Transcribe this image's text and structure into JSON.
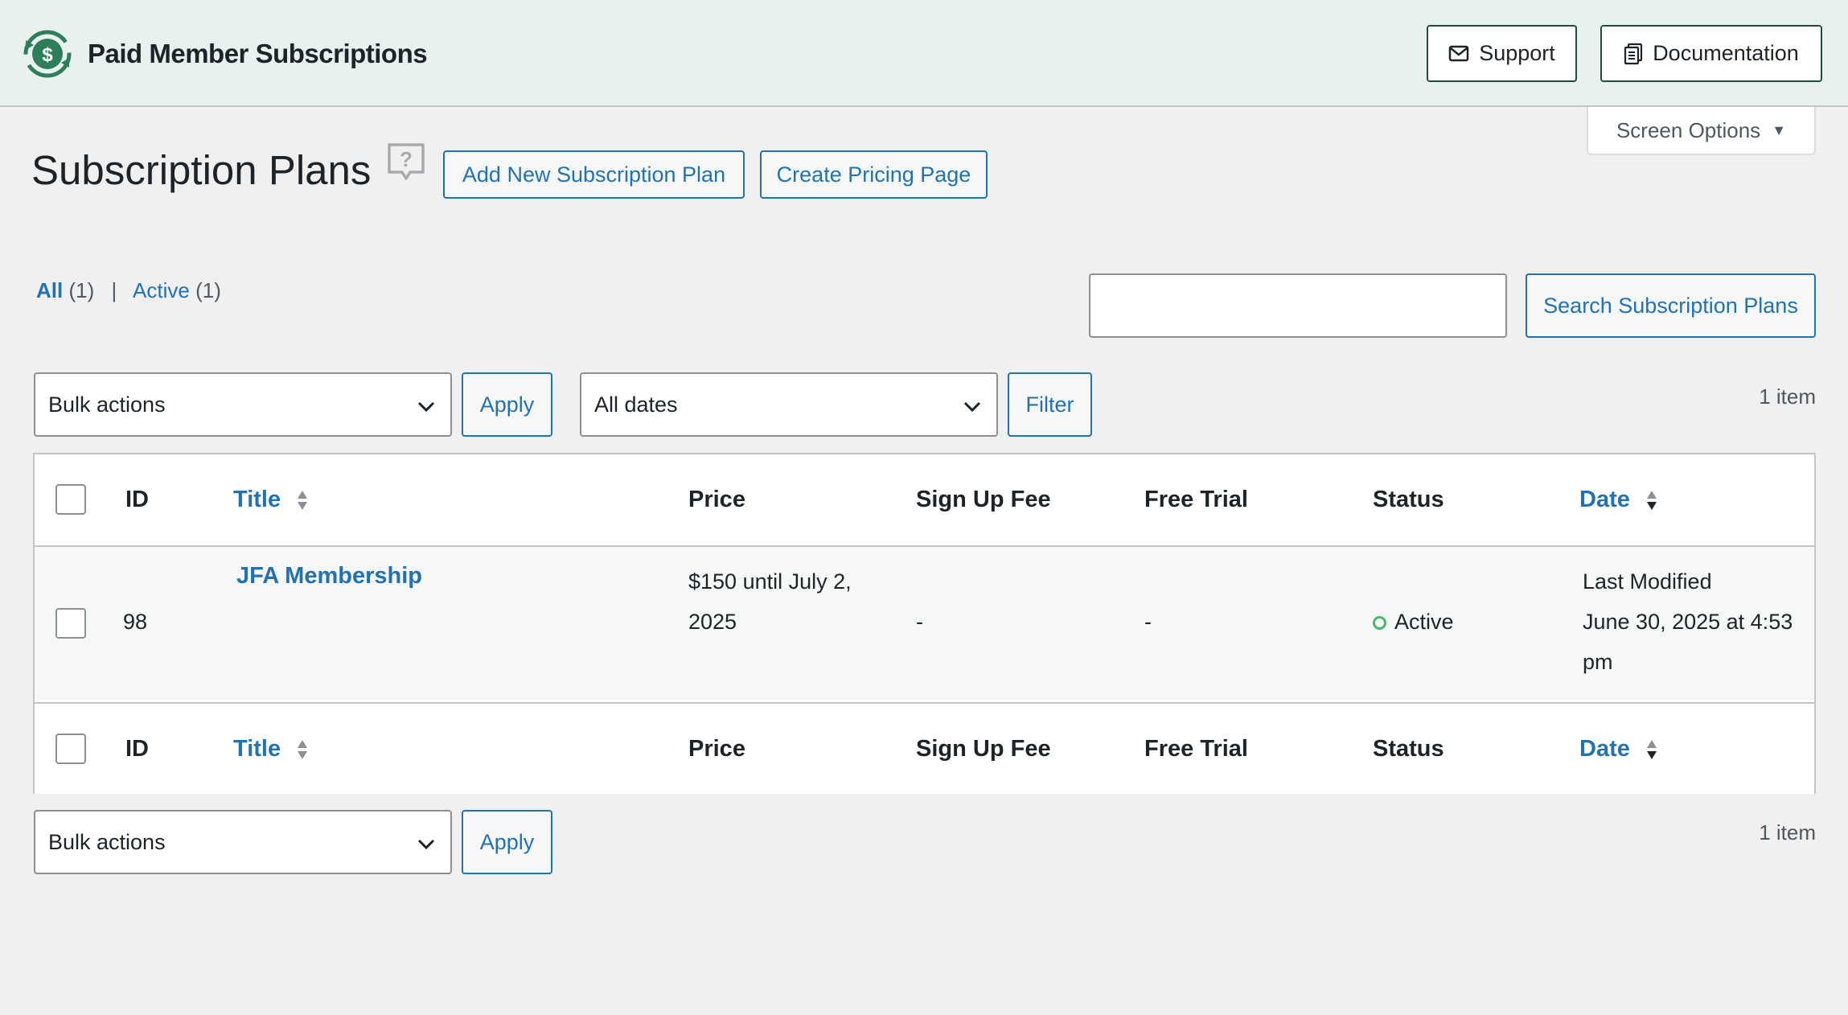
{
  "header": {
    "brand_name": "Paid Member Subscriptions",
    "support_label": "Support",
    "documentation_label": "Documentation"
  },
  "screen_options": {
    "label": "Screen Options"
  },
  "page": {
    "title": "Subscription Plans",
    "add_new_label": "Add New Subscription Plan",
    "create_pricing_label": "Create Pricing Page"
  },
  "views": {
    "all_label": "All",
    "all_count": "(1)",
    "separator": "|",
    "active_label": "Active",
    "active_count": "(1)"
  },
  "search": {
    "value": "",
    "button_label": "Search Subscription Plans"
  },
  "tablenav_top": {
    "bulk_actions": "Bulk actions",
    "apply_label": "Apply",
    "dates": "All dates",
    "filter_label": "Filter",
    "item_count": "1 item"
  },
  "tablenav_bottom": {
    "bulk_actions": "Bulk actions",
    "apply_label": "Apply",
    "item_count": "1 item"
  },
  "table": {
    "columns": {
      "id": "ID",
      "title": "Title",
      "price": "Price",
      "signup_fee": "Sign Up Fee",
      "free_trial": "Free Trial",
      "status": "Status",
      "date": "Date"
    },
    "rows": [
      {
        "id": "98",
        "title": "JFA Membership",
        "price_line1": "$150 until July 2,",
        "price_line2": "2025",
        "signup_fee": "-",
        "free_trial": "-",
        "status": "Active",
        "date_line1": "Last Modified",
        "date_line2": "June 30, 2025 at 4:53",
        "date_line3": "pm"
      }
    ]
  },
  "colors": {
    "header_bg": "#e9f1ee",
    "brand_green": "#1d4d3b",
    "link_blue": "#2271b1",
    "status_green": "#4ab866",
    "page_bg": "#f0f0f1"
  }
}
